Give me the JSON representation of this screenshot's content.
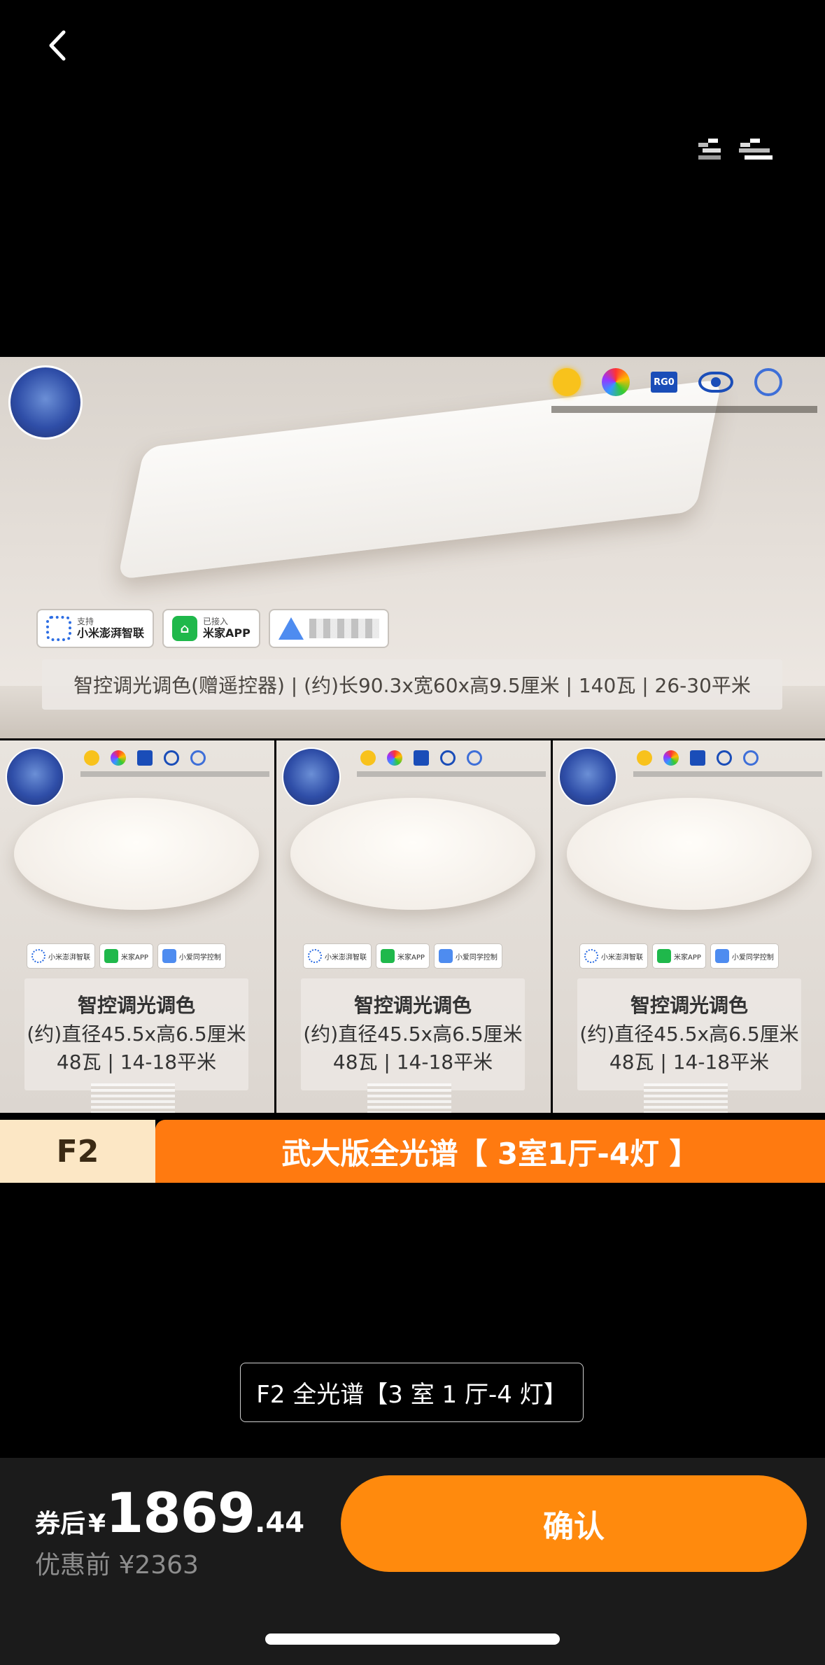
{
  "product_image": {
    "hero": {
      "chips": [
        {
          "line1": "支持",
          "line2": "小米澎湃智联"
        },
        {
          "line1": "已接入",
          "line2": "米家APP"
        }
      ],
      "feature_badge": "RG0",
      "spec_text": "智控调光调色(赠遥控器) | (约)长90.3x宽60x高9.5厘米 | 140瓦 | 26-30平米"
    },
    "tiles": [
      {
        "mini_chips": [
          "小米澎湃智联",
          "米家APP",
          "小爱同学控制"
        ],
        "title": "智控调光调色",
        "size": "(约)直径45.5x高6.5厘米",
        "power": "48瓦 | 14-18平米"
      },
      {
        "mini_chips": [
          "小米澎湃智联",
          "米家APP",
          "小爱同学控制"
        ],
        "title": "智控调光调色",
        "size": "(约)直径45.5x高6.5厘米",
        "power": "48瓦 | 14-18平米"
      },
      {
        "mini_chips": [
          "小米澎湃智联",
          "米家APP",
          "小爱同学控制"
        ],
        "title": "智控调光调色",
        "size": "(约)直径45.5x高6.5厘米",
        "power": "48瓦 | 14-18平米"
      }
    ],
    "banner": {
      "code": "F2",
      "text": "武大版全光谱【 3室1厅-4灯 】"
    }
  },
  "caption": "F2 全光谱【3 室 1 厅-4 灯】",
  "price": {
    "label": "券后",
    "currency": "¥",
    "integer": "1869",
    "decimal": ".44",
    "original": "优惠前 ¥2363"
  },
  "confirm_label": "确认",
  "colors": {
    "accent": "#ff8a0d",
    "banner_orange": "#ff7a10",
    "banner_cream": "#fce7c5"
  },
  "icons": {
    "back": "chevron-left-icon"
  }
}
